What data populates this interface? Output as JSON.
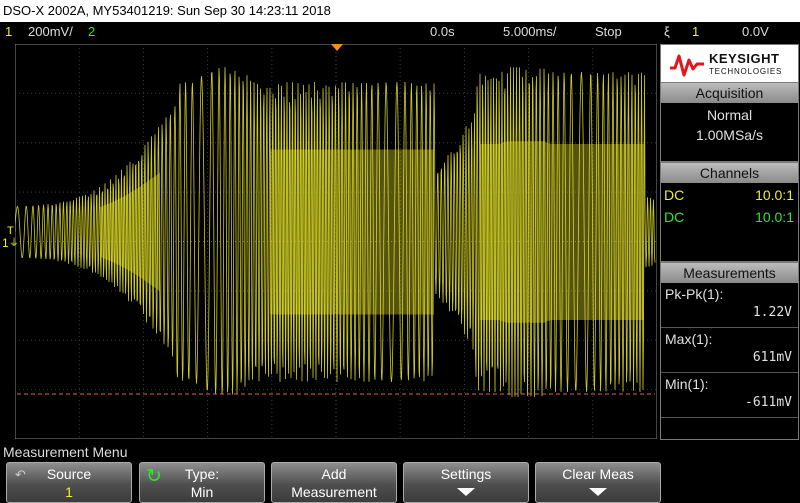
{
  "title": "DSO-X 2002A, MY53401219: Sun Sep 30 14:23:11 2018",
  "status": {
    "ch1_num": "1",
    "ch1_scale": "200mV/",
    "ch2_num": "2",
    "delay": "0.0s",
    "timebase": "5.000ms/",
    "run_state": "Stop",
    "trigger_channel": "1",
    "trigger_level": "0.0V"
  },
  "colors": {
    "channel1": "#f2ee2a",
    "channel2": "#2fe62f",
    "trigger_marker": "#ff8c1a",
    "reference_line": "#e06060",
    "brand_red": "#e3141b"
  },
  "logo": {
    "brand": "KEYSIGHT",
    "sub": "TECHNOLOGIES"
  },
  "acquisition": {
    "header": "Acquisition",
    "mode": "Normal",
    "rate": "1.00MSa/s"
  },
  "channels": {
    "header": "Channels",
    "rows": [
      {
        "coupling": "DC",
        "probe": "10.0:1"
      },
      {
        "coupling": "DC",
        "probe": "10.0:1"
      }
    ]
  },
  "measurements": {
    "header": "Measurements",
    "items": [
      {
        "label": "Pk-Pk(1):",
        "value": "1.22V"
      },
      {
        "label": "Max(1):",
        "value": "611mV"
      },
      {
        "label": "Min(1):",
        "value": "-611mV"
      }
    ]
  },
  "ground_marker": {
    "channel": "1",
    "trigger_mark": "T"
  },
  "menu": {
    "title": "Measurement Menu",
    "softkeys": [
      {
        "line1": "Source",
        "line2": "1"
      },
      {
        "line1": "Type:",
        "line2": "Min"
      },
      {
        "line1": "Add",
        "line2": "Measurement"
      },
      {
        "line1": "Settings",
        "line2": ""
      },
      {
        "line1": "Clear Meas",
        "line2": ""
      }
    ]
  }
}
